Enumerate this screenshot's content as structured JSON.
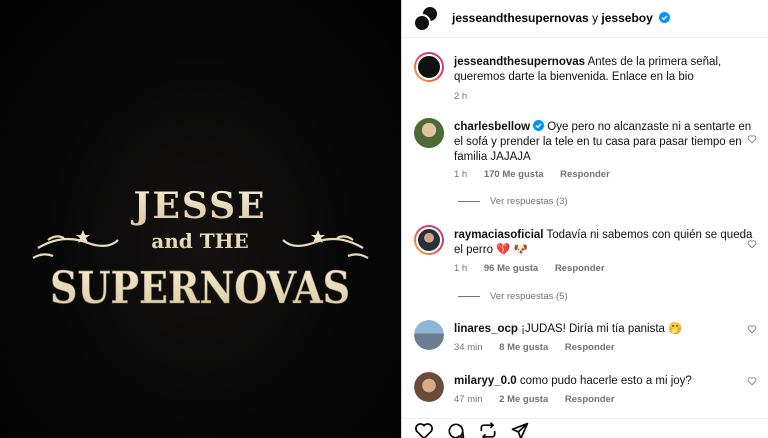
{
  "media": {
    "logo": {
      "line1": "JESSE",
      "line2": "and THE",
      "line3": "SUPERNOVAS"
    }
  },
  "header": {
    "user1": "jesseandthesupernovas",
    "joiner": "y",
    "user2": "jesseboy"
  },
  "caption": {
    "user": "jesseandthesupernovas",
    "text": "Antes de la primera señal, queremos darte la bienvenida. Enlace en la bio",
    "time": "2 h"
  },
  "comments": [
    {
      "user": "charlesbellow",
      "verified": true,
      "text": "Oye pero no alcanzaste ni a sentarte en el sofá y prender la tele en tu casa para pasar tiempo en familia JAJAJA",
      "time": "1 h",
      "likes": "170 Me gusta",
      "reply": "Responder",
      "view_replies": "Ver respuestas (3)"
    },
    {
      "user": "raymaciasoficial",
      "verified": false,
      "text": "Todavía ni sabemos con quién se queda el perro 💔 🐶",
      "time": "1 h",
      "likes": "96 Me gusta",
      "reply": "Responder",
      "view_replies": "Ver respuestas (5)"
    },
    {
      "user": "linares_ocp",
      "verified": false,
      "text": "¡JUDAS! Diría mi tía panista 🤭",
      "time": "34 min",
      "likes": "8 Me gusta",
      "reply": "Responder"
    },
    {
      "user": "milaryy_0.0",
      "verified": false,
      "text": "como pudo hacerle esto a mi joy?",
      "time": "47 min",
      "likes": "2 Me gusta",
      "reply": "Responder"
    }
  ],
  "colors": {
    "verified": "#0095f6",
    "meta": "#737373",
    "logo_cream": "#efe3c4"
  },
  "icons": [
    "heart-icon",
    "comment-icon",
    "share-icon",
    "send-icon",
    "verified-icon"
  ]
}
